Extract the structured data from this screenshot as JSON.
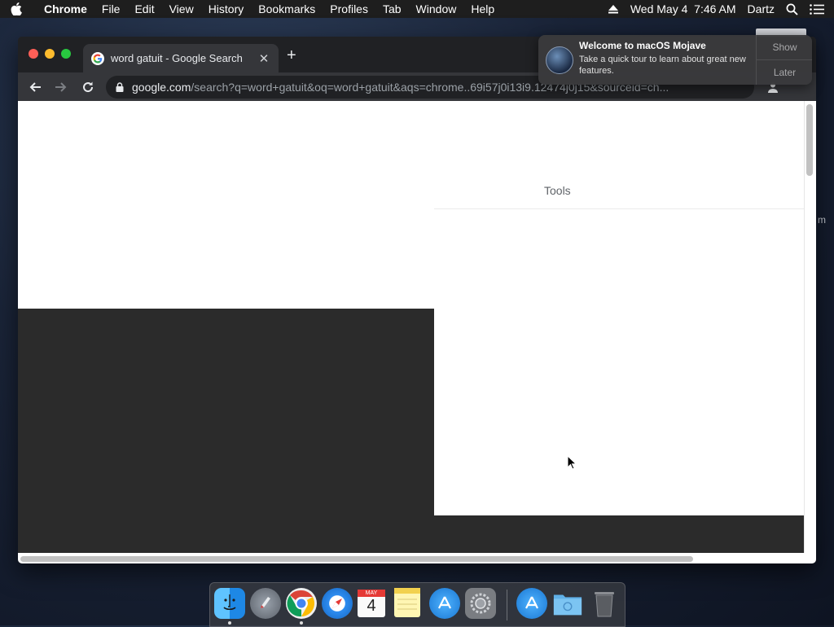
{
  "menubar": {
    "apple_icon": "apple-logo-icon",
    "app_name": "Chrome",
    "menus": [
      "File",
      "Edit",
      "View",
      "History",
      "Bookmarks",
      "Profiles",
      "Tab",
      "Window",
      "Help"
    ],
    "datetime": "Wed May 4  7:46 AM",
    "user": "Dartz",
    "status_icons": [
      "eject-icon",
      "spotlight-search-icon",
      "notification-center-icon"
    ]
  },
  "browser": {
    "tab": {
      "title": "word gatuit - Google Search",
      "favicon": "google-g-icon",
      "close_icon": "close-icon"
    },
    "new_tab_label": "+",
    "url_host": "google.com",
    "url_path": "/search?q=word+gatuit&oq=word+gatuit&aqs=chrome..69i57j0i13i9.12474j0j15&sourceid=ch..."
  },
  "page": {
    "tools_label": "Tools"
  },
  "notification": {
    "title": "Welcome to macOS Mojave",
    "body": "Take a quick tour to learn about great new features.",
    "show_label": "Show",
    "later_label": "Later",
    "icon": "macos-mojave-icon"
  },
  "desktop": {
    "partial_label": "m"
  },
  "dock": {
    "apps": [
      "Finder",
      "Launchpad",
      "Google Chrome",
      "Safari",
      "Calendar",
      "Notes",
      "App Store",
      "System Preferences",
      "App Store",
      "Downloads",
      "Trash"
    ],
    "calendar_month": "MAY",
    "calendar_day": "4"
  },
  "colors": {
    "menubar_bg": "#1e1e1e",
    "tabstrip_bg": "#202124",
    "toolbar_bg": "#35363a",
    "page_dark": "#2b2b2b",
    "close_red": "#ff5f57",
    "minimize_yellow": "#febc2e",
    "zoom_green": "#28c840"
  }
}
